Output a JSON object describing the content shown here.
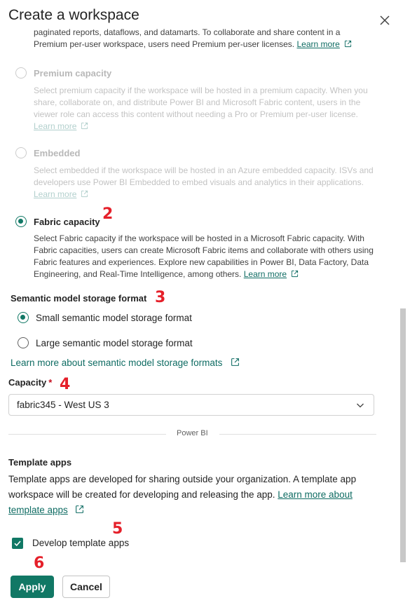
{
  "dialog": {
    "title": "Create a workspace",
    "close_icon": "close-icon"
  },
  "license_intro": {
    "line1": "paginated reports, dataflows, and datamarts. To collaborate and share content in a",
    "line2": "Premium per-user workspace, users need Premium per-user licenses.",
    "learn_more": "Learn more"
  },
  "license_options": [
    {
      "label": "Premium capacity",
      "disabled": true,
      "checked": false,
      "desc_lines": [
        "Select premium capacity if the workspace will be hosted in a premium capacity. When you",
        "share, collaborate on, and distribute Power BI and Microsoft Fabric content, users in the",
        "viewer role can access this content without needing a Pro or Premium per-user license."
      ],
      "learn_more": "Learn more"
    },
    {
      "label": "Embedded",
      "disabled": true,
      "checked": false,
      "desc_lines": [
        "Select embedded if the workspace will be hosted in an Azure embedded capacity. ISVs and",
        "developers use Power BI Embedded to embed visuals and analytics in their applications."
      ],
      "learn_more": "Learn more"
    },
    {
      "label": "Fabric capacity",
      "disabled": false,
      "checked": true,
      "desc_lines": [
        "Select Fabric capacity if the workspace will be hosted in a Microsoft Fabric capacity. With",
        "Fabric capacities, users can create Microsoft Fabric items and collaborate with others using",
        "Fabric features and experiences. Explore new capabilities in Power BI, Data Factory, Data",
        "Engineering, and Real-Time Intelligence, among others."
      ],
      "learn_more": "Learn more"
    }
  ],
  "annotations": [
    "2",
    "3",
    "4",
    "5",
    "6"
  ],
  "storage_format": {
    "heading": "Semantic model storage format",
    "options": [
      {
        "label": "Small semantic model storage format",
        "checked": true
      },
      {
        "label": "Large semantic model storage format",
        "checked": false
      }
    ],
    "learn_more": "Learn more about semantic model storage formats"
  },
  "capacity": {
    "label": "Capacity",
    "required_mark": "*",
    "selected": "fabric345 - West US 3"
  },
  "divider_label": "Power BI",
  "template_apps": {
    "heading": "Template apps",
    "line1": "Template apps are developed for sharing outside your organization. A template app",
    "line2_text": "workspace will be created for developing and releasing the app.",
    "learn_more_part1": "Learn more about",
    "learn_more_part2": "template apps",
    "checkbox_label": "Develop template apps",
    "checkbox_checked": true
  },
  "footer": {
    "apply_label": "Apply",
    "cancel_label": "Cancel"
  },
  "colors": {
    "accent": "#117865",
    "link": "#0f6c63",
    "annotation": "#e5202a"
  }
}
